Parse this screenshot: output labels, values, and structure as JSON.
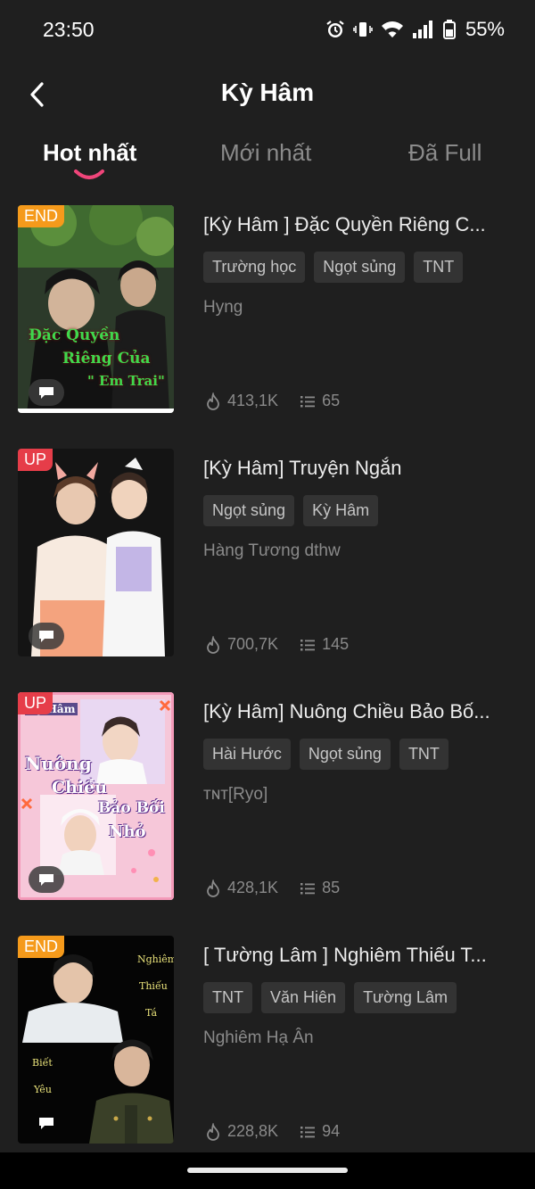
{
  "status_bar": {
    "time": "23:50",
    "battery": "55%"
  },
  "header": {
    "title": "Kỳ Hâm",
    "back_icon": "chevron-left-icon"
  },
  "tabs": [
    {
      "label": "Hot nhất",
      "active": true
    },
    {
      "label": "Mới nhất",
      "active": false
    },
    {
      "label": "Đã Full",
      "active": false
    }
  ],
  "colors": {
    "accent": "#f0457a",
    "background": "#1f1f1f",
    "badge_end": "#f59a1b",
    "badge_up": "#e63d49"
  },
  "stories": [
    {
      "badge": "END",
      "title": "[Kỳ Hâm ] Đặc Quyền Riêng C...",
      "tags": [
        "Trường học",
        "Ngọt sủng",
        "TNT"
      ],
      "author": "Hyng",
      "views": "413,1K",
      "chapters": "65",
      "cover_text": [
        "Đặc Quyền",
        "Riêng Của",
        "\" Em Trai\""
      ]
    },
    {
      "badge": "UP",
      "title": "[Kỳ Hâm] Truyện Ngắn",
      "tags": [
        "Ngọt sủng",
        "Kỳ Hâm"
      ],
      "author": "Hàng Tương dthw",
      "views": "700,7K",
      "chapters": "145",
      "cover_text": []
    },
    {
      "badge": "UP",
      "title": "[Kỳ Hâm] Nuông Chiều Bảo Bố...",
      "tags": [
        "Hài Hước",
        "Ngọt sủng",
        "TNT"
      ],
      "author": "ᴛɴᴛ[Ryo]",
      "views": "428,1K",
      "chapters": "85",
      "cover_text": [
        "Kỳ Hâm",
        "Nuông",
        "Chiều",
        "Bảo Bối",
        "Nhỏ"
      ]
    },
    {
      "badge": "END",
      "title": "[ Tường Lâm ] Nghiêm Thiếu T...",
      "tags": [
        "TNT",
        "Văn Hiên",
        "Tường Lâm"
      ],
      "author": "Nghiêm Hạ Ân",
      "views": "228,8K",
      "chapters": "94",
      "cover_text": [
        "Nghiêm",
        "Thiếu",
        "Tá",
        "Biết",
        "Yêu"
      ]
    }
  ]
}
